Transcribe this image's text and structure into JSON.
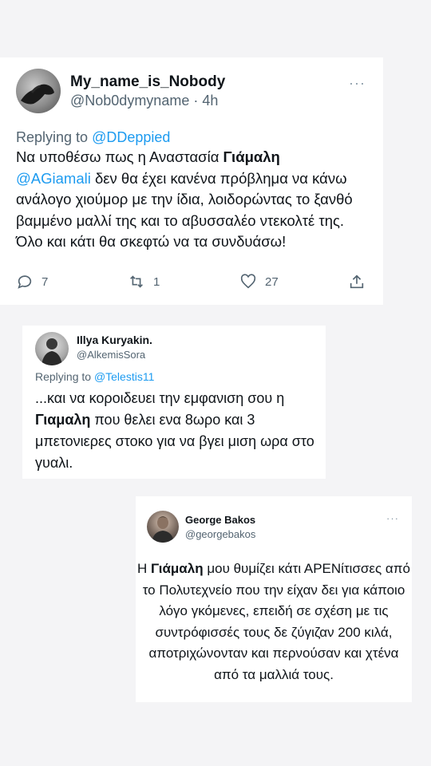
{
  "tweet1": {
    "name": "My_name_is_Nobody",
    "handle": "@Nob0dymyname",
    "time": "· 4h",
    "more": "···",
    "replying_prefix": "Replying to ",
    "replying_handle": "@DDeppied",
    "body": {
      "p1": "Να υποθέσω πως η Αναστασία ",
      "bold": "Γιάμαλη",
      "mention": "@AGiamali",
      "p2": " δεν θα έχει κανένα πρόβλημα να κάνω ανάλογο χιούμορ με την ίδια, λοιδορώντας το ξανθό βαμμένο μαλλί της και το αβυσσαλέο ντεκολτέ της.",
      "p3": "Όλο και κάτι θα σκεφτώ να τα συνδυάσω!"
    },
    "replies": "7",
    "retweets": "1",
    "likes": "27"
  },
  "tweet2": {
    "name": "Illya Kuryakin.",
    "handle": "@AlkemisSora",
    "replying_prefix": "Replying to ",
    "replying_handle": "@Telestis11",
    "body": {
      "p1": "...και να κοροιδευει την εμφανιση σου η ",
      "bold": "Γιαμαλη",
      "p2": " που θελει ενα 8ωρο και 3 μπετονιερες στοκο για να βγει μιση ωρα στο γυαλι."
    }
  },
  "tweet3": {
    "name": "George Bakos",
    "handle": "@georgebakos",
    "more": "···",
    "body": {
      "p1": "Η ",
      "bold": "Γιάμαλη",
      "p2": " μου θυμίζει κάτι ΑΡΕΝίτισσες από το Πολυτεχνείο που την είχαν δει για κάποιο λόγο γκόμενες, επειδή σε σχέση με τις συντρόφισσές τους δε ζύγιζαν 200 κιλά, αποτριχώνονταν και περνούσαν και χτένα από τα μαλλιά τους."
    }
  }
}
